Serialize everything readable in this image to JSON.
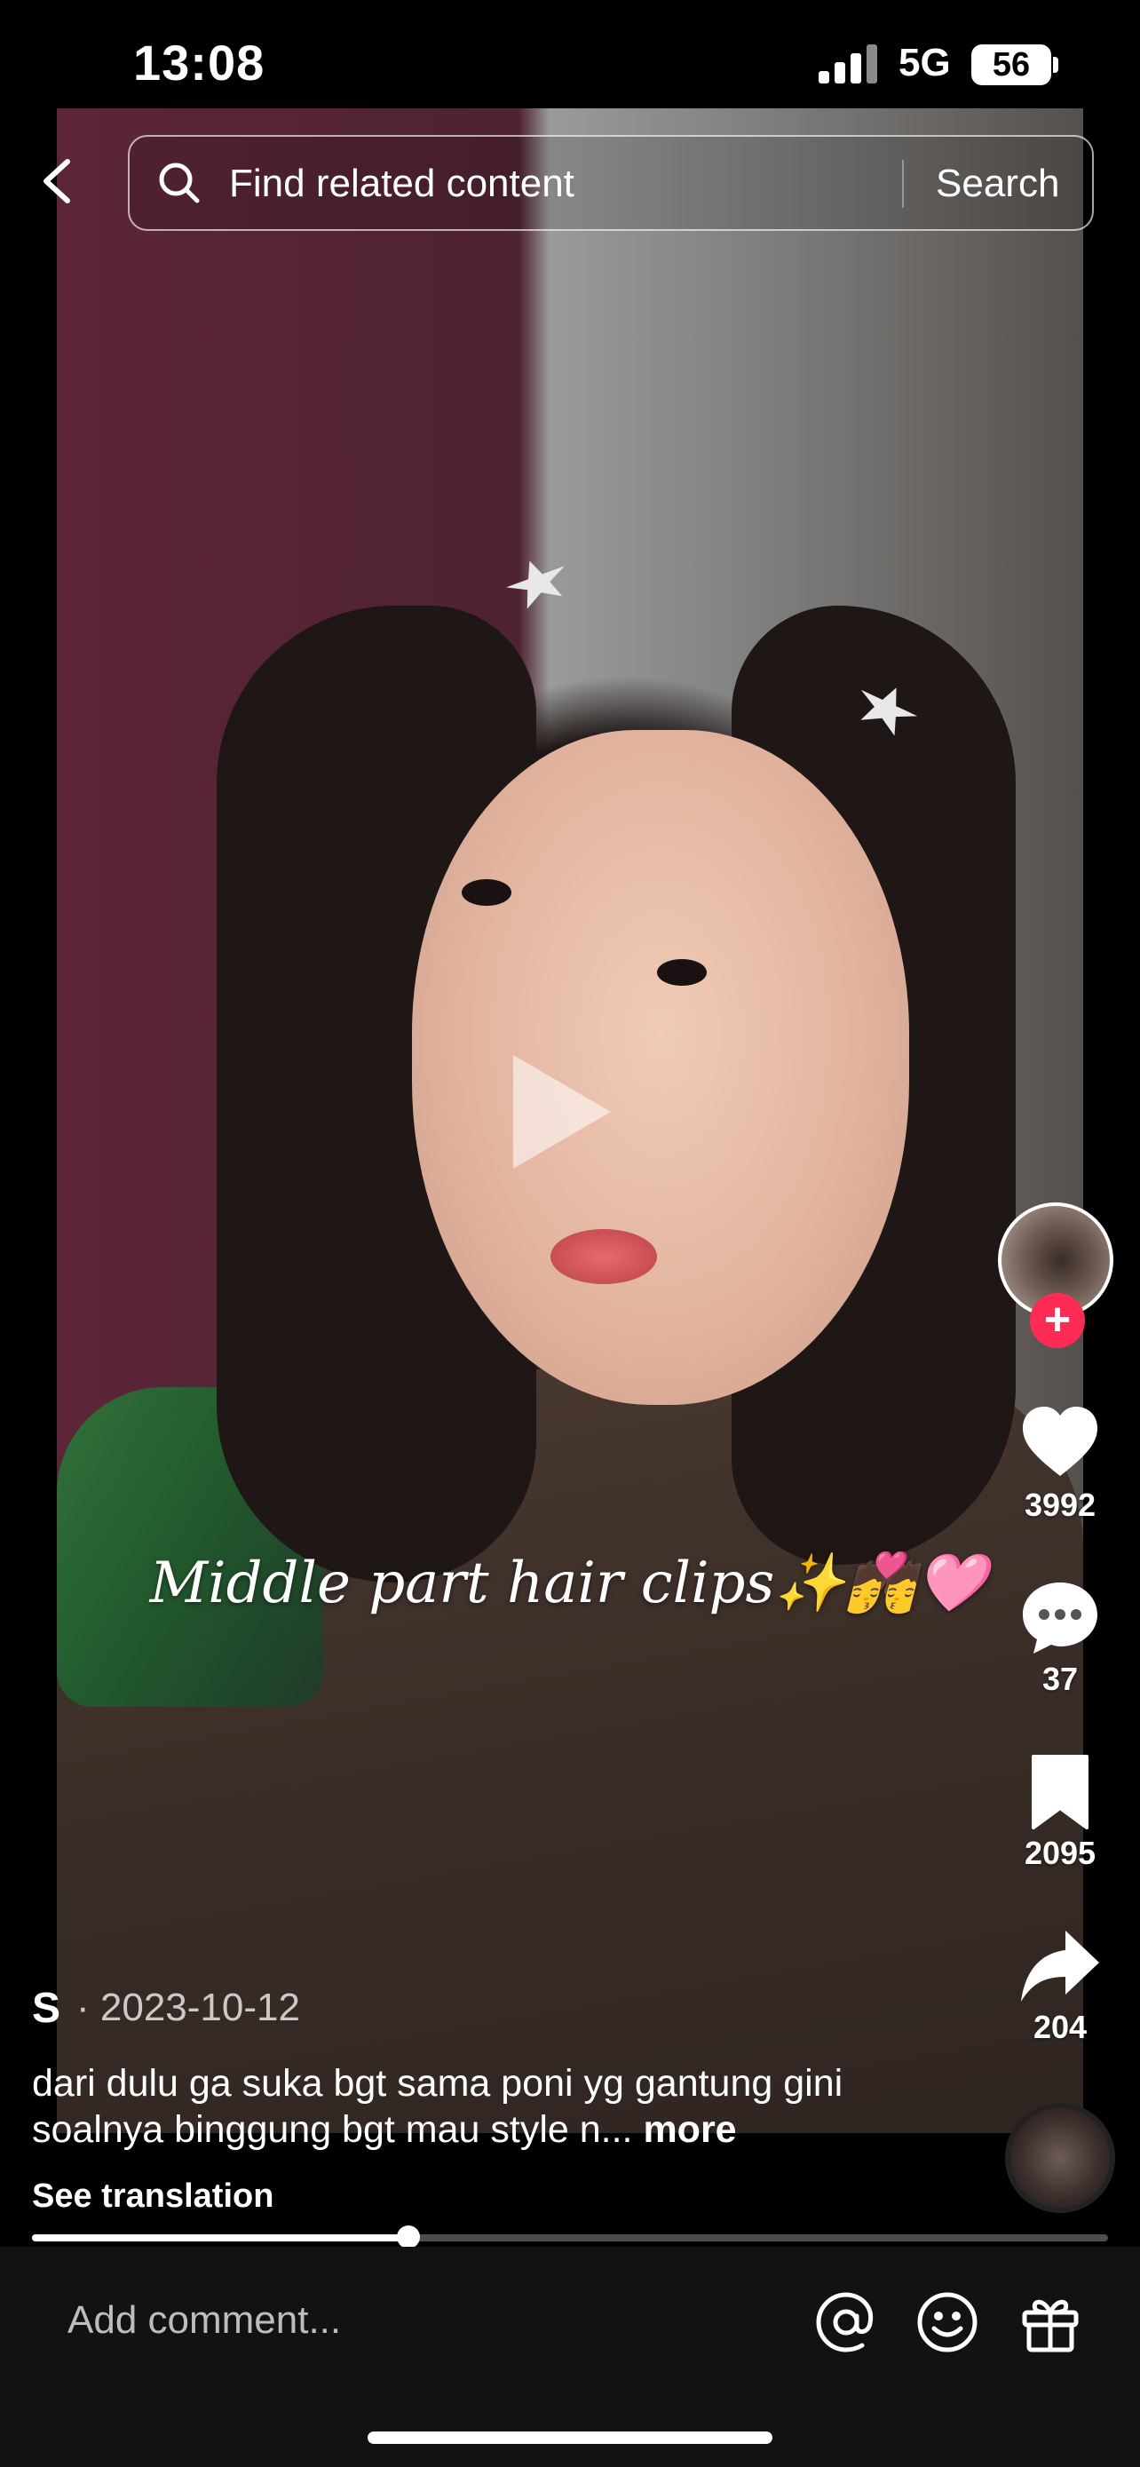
{
  "status_bar": {
    "time": "13:08",
    "network": "5G",
    "battery": "56"
  },
  "search": {
    "placeholder": "Find related content",
    "button": "Search"
  },
  "video": {
    "overlay_caption": "Middle part hair clips✨💏🩷"
  },
  "rail": {
    "likes": "3992",
    "comments": "37",
    "saves": "2095",
    "shares": "204",
    "follow": "+"
  },
  "post": {
    "author": "S",
    "date": "· 2023-10-12",
    "description": "dari dulu ga suka bgt sama poni yg gantung gini soalnya binggung bgt mau style n...",
    "more": "more",
    "see_translation": "See translation",
    "progress": 0.35
  },
  "comment_bar": {
    "placeholder": "Add comment..."
  },
  "icons": [
    "back-arrow-icon",
    "search-icon",
    "play-icon",
    "heart-icon",
    "comment-icon",
    "bookmark-icon",
    "share-icon",
    "at-icon",
    "emoji-icon",
    "gift-icon"
  ]
}
